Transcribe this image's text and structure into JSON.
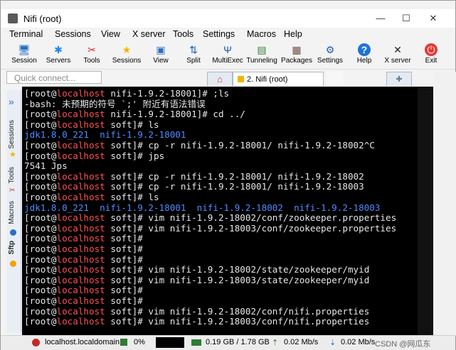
{
  "window": {
    "title": "Nifi (root)",
    "controls": {
      "minimize": "—",
      "maximize": "☐",
      "close": "✕"
    }
  },
  "menu": [
    "Terminal",
    "Sessions",
    "View",
    "X server",
    "Tools",
    "Settings",
    "Macros",
    "Help"
  ],
  "toolbar": [
    {
      "label": "Session",
      "icon": "session-icon",
      "glyph": "🖥",
      "color": "#2b6fc1"
    },
    {
      "label": "Servers",
      "icon": "servers-icon",
      "glyph": "✱",
      "color": "#1e88e5"
    },
    {
      "label": "Tools",
      "icon": "tools-icon",
      "glyph": "✂",
      "color": "#d32f2f"
    },
    {
      "label": "Sessions",
      "icon": "sessions-star-icon",
      "glyph": "★",
      "color": "#f4b400"
    },
    {
      "label": "View",
      "icon": "view-icon",
      "glyph": "▣",
      "color": "#2b6fc1"
    },
    {
      "label": "Split",
      "icon": "split-icon",
      "glyph": "⇅",
      "color": "#1565c0"
    },
    {
      "label": "MultiExec",
      "icon": "multiexec-icon",
      "glyph": "Ψ",
      "color": "#1a56b8"
    },
    {
      "label": "Tunneling",
      "icon": "tunneling-icon",
      "glyph": "▤",
      "color": "#2e7d32"
    },
    {
      "label": "Packages",
      "icon": "packages-icon",
      "glyph": "▦",
      "color": "#6d4c41"
    },
    {
      "label": "Settings",
      "icon": "settings-icon",
      "glyph": "⚙",
      "color": "#1e5bb8"
    },
    {
      "label": "Help",
      "icon": "help-icon",
      "glyph": "?",
      "color": "#ffffff"
    },
    {
      "label": "X server",
      "icon": "xserver-icon",
      "glyph": "✕",
      "color": "#222222"
    },
    {
      "label": "Exit",
      "icon": "exit-icon",
      "glyph": "⏻",
      "color": "#ffffff"
    }
  ],
  "quick_connect": {
    "placeholder": "Quick connect..."
  },
  "tabs": {
    "home_glyph": "⌂",
    "active": "2. Nifi (root)",
    "new_tab_glyph": "✚"
  },
  "sidebar": {
    "sessions": "Sessions",
    "tools": "Tools",
    "macros": "Macros",
    "sftp": "Sftp",
    "arrow": "»"
  },
  "terminal": {
    "lines": [
      {
        "type": "prompt",
        "dir": "nifi-1.9.2-18001",
        "cmd": ";ls"
      },
      {
        "type": "text",
        "text": "-bash: 未预期的符号 `;' 附近有语法错误"
      },
      {
        "type": "prompt",
        "dir": "nifi-1.9.2-18001",
        "cmd": "cd ../"
      },
      {
        "type": "prompt",
        "dir": "soft",
        "cmd": "ls"
      },
      {
        "type": "blue",
        "text": "jdk1.8.0_221  nifi-1.9.2-18001"
      },
      {
        "type": "prompt",
        "dir": "soft",
        "cmd": "cp -r nifi-1.9.2-18001/ nifi-1.9.2-18002^C"
      },
      {
        "type": "prompt",
        "dir": "soft",
        "cmd": "jps"
      },
      {
        "type": "text",
        "text": "7541 Jps"
      },
      {
        "type": "prompt",
        "dir": "soft",
        "cmd": "cp -r nifi-1.9.2-18001/ nifi-1.9.2-18002"
      },
      {
        "type": "prompt",
        "dir": "soft",
        "cmd": "cp -r nifi-1.9.2-18001/ nifi-1.9.2-18003"
      },
      {
        "type": "prompt",
        "dir": "soft",
        "cmd": "ls"
      },
      {
        "type": "blue",
        "text": "jdk1.8.0_221  nifi-1.9.2-18001  nifi-1.9.2-18002  nifi-1.9.2-18003"
      },
      {
        "type": "prompt",
        "dir": "soft",
        "cmd": "vim nifi-1.9.2-18002/conf/zookeeper.properties"
      },
      {
        "type": "prompt",
        "dir": "soft",
        "cmd": "vim nifi-1.9.2-18003/conf/zookeeper.properties"
      },
      {
        "type": "prompt",
        "dir": "soft",
        "cmd": ""
      },
      {
        "type": "prompt",
        "dir": "soft",
        "cmd": ""
      },
      {
        "type": "prompt",
        "dir": "soft",
        "cmd": ""
      },
      {
        "type": "prompt",
        "dir": "soft",
        "cmd": "vim nifi-1.9.2-18002/state/zookeeper/myid"
      },
      {
        "type": "prompt",
        "dir": "soft",
        "cmd": "vim nifi-1.9.2-18003/state/zookeeper/myid"
      },
      {
        "type": "prompt",
        "dir": "soft",
        "cmd": ""
      },
      {
        "type": "prompt",
        "dir": "soft",
        "cmd": ""
      },
      {
        "type": "prompt",
        "dir": "soft",
        "cmd": "vim nifi-1.9.2-18002/conf/nifi.properties"
      },
      {
        "type": "prompt",
        "dir": "soft",
        "cmd": "vim nifi-1.9.2-18003/conf/nifi.properties"
      }
    ],
    "user": "root",
    "host": "localhost"
  },
  "status": {
    "host": "localhost.localdomain",
    "cpu": "0%",
    "memory": "0.19 GB / 1.78 GB",
    "upload": "0.02 Mb/s",
    "download": "0.02 Mb/s",
    "watermark": "CSDN @网瓜东"
  }
}
